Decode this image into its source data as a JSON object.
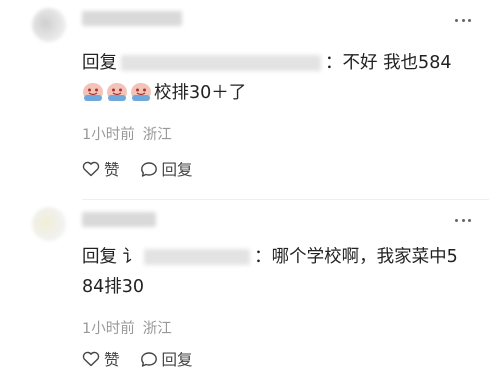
{
  "comments": [
    {
      "reply_word": "回复",
      "text_line1_tail": "：不好 我也584",
      "emojis": [
        "grinning-face-emoji",
        "grinning-face-emoji",
        "grinning-face-emoji"
      ],
      "text_line2": "校排30＋了",
      "time": "1小时前",
      "location": "浙江",
      "like_label": "赞",
      "reply_label": "回复"
    },
    {
      "reply_word": "回复",
      "text_line1_prefix": "ï¼",
      "text_line1_tail": "：哪个学校啊，我家菜中5",
      "text_line2": "84排30",
      "time": "1小时前",
      "location": "浙江",
      "like_label": "赞",
      "reply_label": "回复"
    }
  ],
  "colors": {
    "text": "#222222",
    "meta": "#999999",
    "icon": "#444444"
  }
}
